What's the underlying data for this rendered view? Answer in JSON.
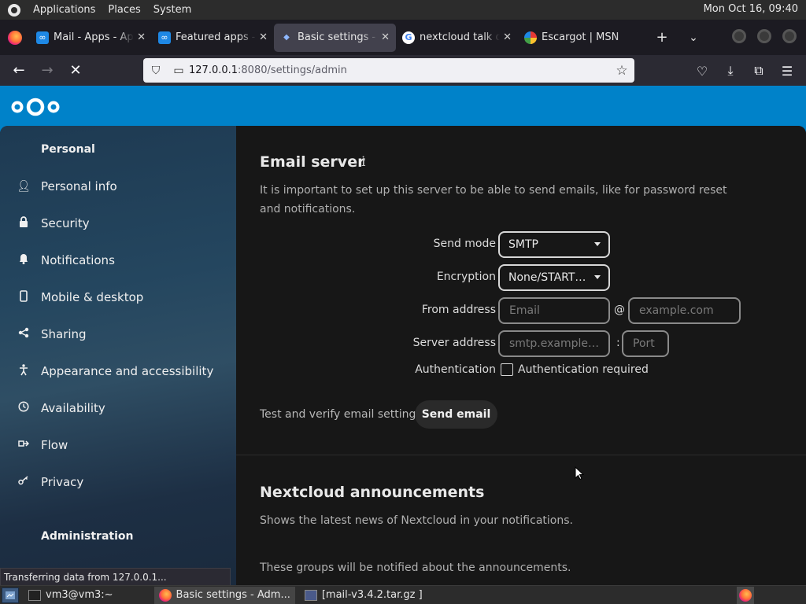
{
  "topbar": {
    "menus": [
      "Applications",
      "Places",
      "System"
    ],
    "clock": "Mon Oct 16, 09:40"
  },
  "tabs": [
    {
      "title": "Mail - Apps - Ap",
      "favicon": "nextcloud-icon"
    },
    {
      "title": "Featured apps -",
      "favicon": "nextcloud-icon"
    },
    {
      "title": "Basic settings -",
      "favicon": "loading-icon",
      "active": true
    },
    {
      "title": "nextcloud talk d",
      "favicon": "google-icon"
    },
    {
      "title": "Escargot | MSN",
      "favicon": "escargot-icon"
    }
  ],
  "urlbar": {
    "host": "127.0.0.1",
    "path": ":8080/settings/admin"
  },
  "sidebar": {
    "personal_caption": "Personal",
    "items": [
      {
        "label": "Personal info",
        "icon": "person-icon"
      },
      {
        "label": "Security",
        "icon": "lock-icon"
      },
      {
        "label": "Notifications",
        "icon": "bell-icon"
      },
      {
        "label": "Mobile & desktop",
        "icon": "phone-icon"
      },
      {
        "label": "Sharing",
        "icon": "share-icon"
      },
      {
        "label": "Appearance and accessibility",
        "icon": "accessibility-icon"
      },
      {
        "label": "Availability",
        "icon": "clock-icon"
      },
      {
        "label": "Flow",
        "icon": "flow-icon"
      },
      {
        "label": "Privacy",
        "icon": "key-icon"
      }
    ],
    "admin_caption": "Administration"
  },
  "email": {
    "title": "Email server",
    "info_glyph": "i",
    "description": "It is important to set up this server to be able to send emails, like for password reset and notifications.",
    "send_mode_label": "Send mode",
    "send_mode_value": "SMTP",
    "encryption_label": "Encryption",
    "encryption_value": "None/STARTTLS",
    "from_label": "From address",
    "from_placeholder": "Email",
    "at_sign": "@",
    "domain_placeholder": "example.com",
    "server_label": "Server address",
    "server_placeholder": "smtp.example.com",
    "colon": ":",
    "port_placeholder": "Port",
    "auth_label": "Authentication",
    "auth_checkbox_label": "Authentication required",
    "test_label": "Test and verify email settings",
    "send_button": "Send email"
  },
  "announcements": {
    "title": "Nextcloud announcements",
    "description": "Shows the latest news of Nextcloud in your notifications.",
    "groups_text": "These groups will be notified about the announcements."
  },
  "status": "Transferring data from 127.0.0.1...",
  "taskbar": {
    "items": [
      "vm3@vm3:~",
      "Basic settings - Adm...",
      "[mail-v3.4.2.tar.gz ]"
    ]
  },
  "colors": {
    "nextcloud_blue": "#0082c9",
    "background": "#171717"
  }
}
